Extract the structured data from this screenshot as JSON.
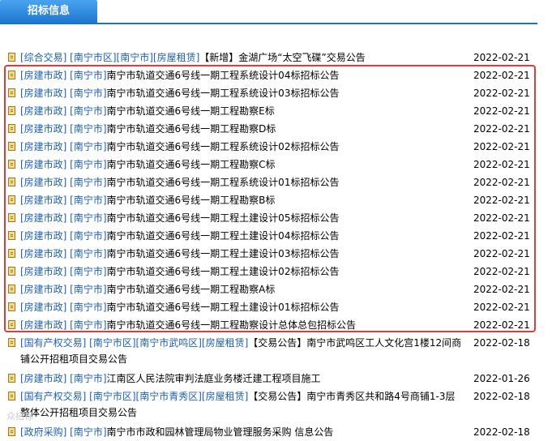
{
  "header": {
    "tab_label": "招标信息"
  },
  "rows": [
    {
      "tags": "[综合交易] [南宁市区][南宁市][房屋租赁]",
      "title": "【新增】金湖广场“太空飞碟”交易公告",
      "date": "2022-02-21",
      "two_line": false
    },
    {
      "tags": "[房建市政] [南宁市]",
      "title": "南宁市轨道交通6号线一期工程系统设计04标招标公告",
      "date": "2022-02-21",
      "two_line": false
    },
    {
      "tags": "[房建市政] [南宁市]",
      "title": "南宁市轨道交通6号线一期工程系统设计03标招标公告",
      "date": "2022-02-21",
      "two_line": false
    },
    {
      "tags": "[房建市政] [南宁市]",
      "title": "南宁市轨道交通6号线一期工程勘察E标",
      "date": "2022-02-21",
      "two_line": false
    },
    {
      "tags": "[房建市政] [南宁市]",
      "title": "南宁市轨道交通6号线一期工程勘察D标",
      "date": "2022-02-21",
      "two_line": false
    },
    {
      "tags": "[房建市政] [南宁市]",
      "title": "南宁市轨道交通6号线一期工程系统设计02标招标公告",
      "date": "2022-02-21",
      "two_line": false
    },
    {
      "tags": "[房建市政] [南宁市]",
      "title": "南宁市轨道交通6号线一期工程勘察C标",
      "date": "2022-02-21",
      "two_line": false
    },
    {
      "tags": "[房建市政] [南宁市]",
      "title": "南宁市轨道交通6号线一期工程系统设计01标招标公告",
      "date": "2022-02-21",
      "two_line": false
    },
    {
      "tags": "[房建市政] [南宁市]",
      "title": "南宁市轨道交通6号线一期工程勘察B标",
      "date": "2022-02-21",
      "two_line": false
    },
    {
      "tags": "[房建市政] [南宁市]",
      "title": "南宁市轨道交通6号线一期工程土建设计05标招标公告",
      "date": "2022-02-21",
      "two_line": false
    },
    {
      "tags": "[房建市政] [南宁市]",
      "title": "南宁市轨道交通6号线一期工程土建设计04标招标公告",
      "date": "2022-02-21",
      "two_line": false
    },
    {
      "tags": "[房建市政] [南宁市]",
      "title": "南宁市轨道交通6号线一期工程土建设计03标招标公告",
      "date": "2022-02-21",
      "two_line": false
    },
    {
      "tags": "[房建市政] [南宁市]",
      "title": "南宁市轨道交通6号线一期工程土建设计02标招标公告",
      "date": "2022-02-21",
      "two_line": false
    },
    {
      "tags": "[房建市政] [南宁市]",
      "title": "南宁市轨道交通6号线一期工程勘察A标",
      "date": "2022-02-21",
      "two_line": false
    },
    {
      "tags": "[房建市政] [南宁市]",
      "title": "南宁市轨道交通6号线一期工程土建设计01标招标公告",
      "date": "2022-02-21",
      "two_line": false
    },
    {
      "tags": "[房建市政] [南宁市]",
      "title": "南宁市轨道交通6号线一期工程勘察设计总体总包招标公告",
      "date": "2022-02-21",
      "two_line": false
    },
    {
      "tags": "[国有产权交易] [南宁市区][南宁市武鸣区][房屋租赁]",
      "title": "【交易公告】南宁市武鸣区工人文化宫1楼12间商铺公开招租项目交易公告",
      "date": "2022-02-18",
      "two_line": true
    },
    {
      "tags": "[房建市政] [南宁市]",
      "title": "江南区人民法院审判法庭业务楼迁建工程项目施工",
      "date": "2022-01-26",
      "two_line": false
    },
    {
      "tags": "[国有产权交易] [南宁市区][南宁市青秀区][房屋租赁]",
      "title": "【交易公告】南宁市青秀区共和路4号商铺1-3层整体公开招租项目交易公告",
      "date": "2022-02-18",
      "two_line": true
    },
    {
      "tags": "[政府采购] [南宁市]",
      "title": "南宁市市政和园林管理局物业管理服务采购 信息公告",
      "date": "2022-02-18",
      "two_line": false
    }
  ]
}
